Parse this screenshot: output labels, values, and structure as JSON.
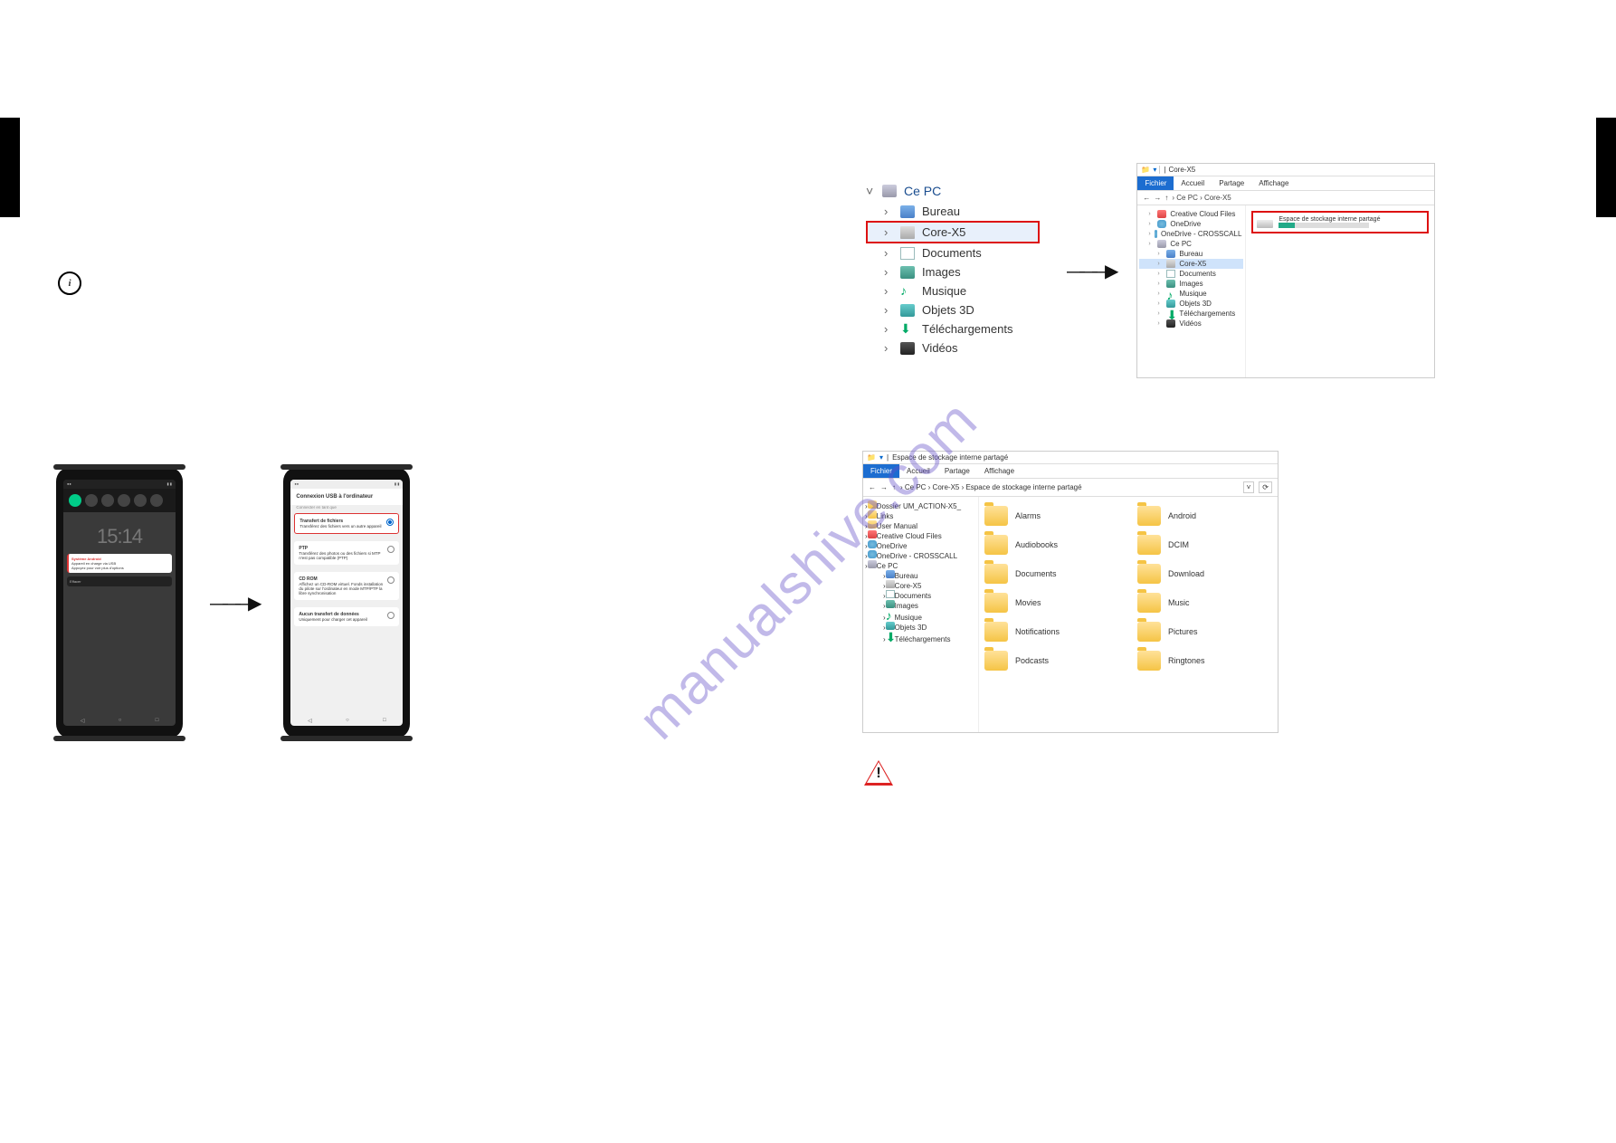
{
  "watermark": "manualshive.com",
  "page_numbers": {
    "left": "",
    "right": ""
  },
  "left_page": {
    "notification_panel": {
      "time": "15:14",
      "system_label": "Système Android",
      "usb_status_title": "Appareil en charge via USB",
      "usb_status_sub": "Appuyez pour voir plus d'options",
      "clear": "Effacer"
    },
    "usb_dialog": {
      "header": "Connexion USB à l'ordinateur",
      "subheader": "Connecter en tant que",
      "options": [
        {
          "title": "Transfert de fichiers",
          "desc": "Transférez des fichiers vers un autre appareil"
        },
        {
          "title": "PTP",
          "desc": "Transférez des photos ou des fichiers si MTP n'est pas compatible (PTP)"
        },
        {
          "title": "CD ROM",
          "desc": "Affichez un CD-ROM virtuel. Fonds installation du pilote sur l'ordinateur en mode MTP/PTP la libre synchronisation"
        },
        {
          "title": "Aucun transfert de données",
          "desc": "Uniquement pour charger cet appareil"
        }
      ]
    }
  },
  "right_page": {
    "tree1": {
      "root": "Ce PC",
      "items": [
        {
          "label": "Bureau",
          "icon": "desktop"
        },
        {
          "label": "Core-X5",
          "icon": "phone",
          "highlight": true
        },
        {
          "label": "Documents",
          "icon": "docs"
        },
        {
          "label": "Images",
          "icon": "images"
        },
        {
          "label": "Musique",
          "icon": "music"
        },
        {
          "label": "Objets 3D",
          "icon": "3d"
        },
        {
          "label": "Téléchargements",
          "icon": "dl"
        },
        {
          "label": "Vidéos",
          "icon": "video"
        }
      ]
    },
    "mini_explorer": {
      "title": "Core-X5",
      "tabs": [
        "Fichier",
        "Accueil",
        "Partage",
        "Affichage"
      ],
      "breadcrumb": "› Ce PC › Core-X5",
      "side_items": [
        {
          "label": "Creative Cloud Files",
          "icon": "cc"
        },
        {
          "label": "OneDrive",
          "icon": "onedrive"
        },
        {
          "label": "OneDrive - CROSSCALL",
          "icon": "onedrive"
        },
        {
          "label": "Ce PC",
          "icon": "pc"
        },
        {
          "label": "Bureau",
          "icon": "desktop",
          "indent": true
        },
        {
          "label": "Core-X5",
          "icon": "phone",
          "indent": true,
          "highlight": true
        },
        {
          "label": "Documents",
          "icon": "docs",
          "indent": true
        },
        {
          "label": "Images",
          "icon": "images",
          "indent": true
        },
        {
          "label": "Musique",
          "icon": "music",
          "indent": true
        },
        {
          "label": "Objets 3D",
          "icon": "3d",
          "indent": true
        },
        {
          "label": "Téléchargements",
          "icon": "dl",
          "indent": true
        },
        {
          "label": "Vidéos",
          "icon": "video",
          "indent": true
        }
      ],
      "storage_label": "Espace de stockage interne partagé"
    },
    "big_explorer": {
      "title": "Espace de stockage interne partagé",
      "tabs": [
        "Fichier",
        "Accueil",
        "Partage",
        "Affichage"
      ],
      "breadcrumb": "› Ce PC › Core-X5 › Espace de stockage interne partagé",
      "side_items": [
        {
          "label": "Dossier UM_ACTION-X5_",
          "icon": "folder"
        },
        {
          "label": "Links",
          "icon": "folder"
        },
        {
          "label": "User Manual",
          "icon": "folder"
        },
        {
          "label": "Creative Cloud Files",
          "icon": "cc"
        },
        {
          "label": "OneDrive",
          "icon": "onedrive"
        },
        {
          "label": "OneDrive - CROSSCALL",
          "icon": "onedrive"
        },
        {
          "label": "Ce PC",
          "icon": "pc"
        },
        {
          "label": "Bureau",
          "icon": "desktop",
          "indent": true
        },
        {
          "label": "Core-X5",
          "icon": "phone",
          "indent": true,
          "highlight": true
        },
        {
          "label": "Documents",
          "icon": "docs",
          "indent": true
        },
        {
          "label": "Images",
          "icon": "images",
          "indent": true
        },
        {
          "label": "Musique",
          "icon": "music",
          "indent": true
        },
        {
          "label": "Objets 3D",
          "icon": "3d",
          "indent": true
        },
        {
          "label": "Téléchargements",
          "icon": "dl",
          "indent": true
        }
      ],
      "folders": [
        "Alarms",
        "Android",
        "Audiobooks",
        "DCIM",
        "Documents",
        "Download",
        "Movies",
        "Music",
        "Notifications",
        "Pictures",
        "Podcasts",
        "Ringtones"
      ]
    }
  }
}
